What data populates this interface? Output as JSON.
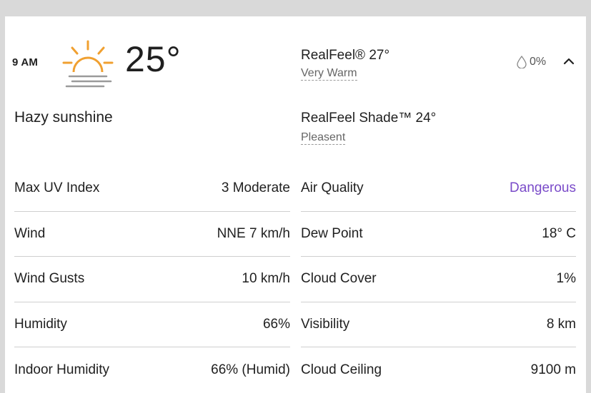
{
  "header": {
    "time": "9 AM",
    "temperature": "25°",
    "condition": "Hazy sunshine",
    "weather_icon": "hazy-sun-icon"
  },
  "realfeel": {
    "label": "RealFeel® 27°",
    "description": "Very Warm"
  },
  "realfeel_shade": {
    "label": "RealFeel Shade™ 24°",
    "description": "Pleasent"
  },
  "precipitation": {
    "icon": "raindrop-icon",
    "value": "0%"
  },
  "details_left": [
    {
      "label": "Max UV Index",
      "value": "3 Moderate"
    },
    {
      "label": "Wind",
      "value": "NNE 7 km/h"
    },
    {
      "label": "Wind Gusts",
      "value": "10 km/h"
    },
    {
      "label": "Humidity",
      "value": "66%"
    },
    {
      "label": "Indoor Humidity",
      "value": "66% (Humid)"
    }
  ],
  "details_right": [
    {
      "label": "Air Quality",
      "value": "Dangerous"
    },
    {
      "label": "Dew Point",
      "value": "18° C"
    },
    {
      "label": "Cloud Cover",
      "value": "1%"
    },
    {
      "label": "Visibility",
      "value": "8 km"
    },
    {
      "label": "Cloud Ceiling",
      "value": "9100 m"
    }
  ],
  "colors": {
    "accent_sun": "#f0a030",
    "air_quality_dangerous": "#7a4bc9",
    "divider": "#cfcfcf"
  }
}
